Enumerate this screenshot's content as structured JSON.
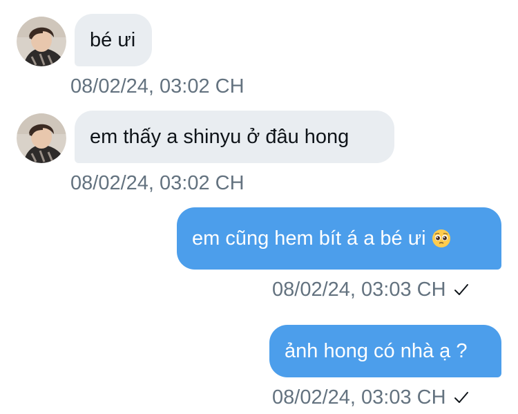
{
  "messages": [
    {
      "direction": "in",
      "text": "bé ưi",
      "timestamp": "08/02/24, 03:02 CH"
    },
    {
      "direction": "in",
      "text": "em thấy a shinyu ở đâu hong",
      "timestamp": "08/02/24, 03:02 CH"
    },
    {
      "direction": "out",
      "text": "em cũng hem bít á a bé ưi",
      "emoji": "pleading-face-emoji",
      "timestamp": "08/02/24, 03:03 CH",
      "status_icon": "read-check-icon"
    },
    {
      "direction": "out",
      "text": "ảnh hong có nhà ạ ?",
      "timestamp": "08/02/24, 03:03 CH",
      "status_icon": "read-check-icon"
    }
  ],
  "colors": {
    "incoming_bubble": "#e9edf1",
    "outgoing_bubble": "#4c9eeb",
    "timestamp_text": "#63727f",
    "incoming_text": "#0f1419",
    "outgoing_text": "#ffffff"
  }
}
